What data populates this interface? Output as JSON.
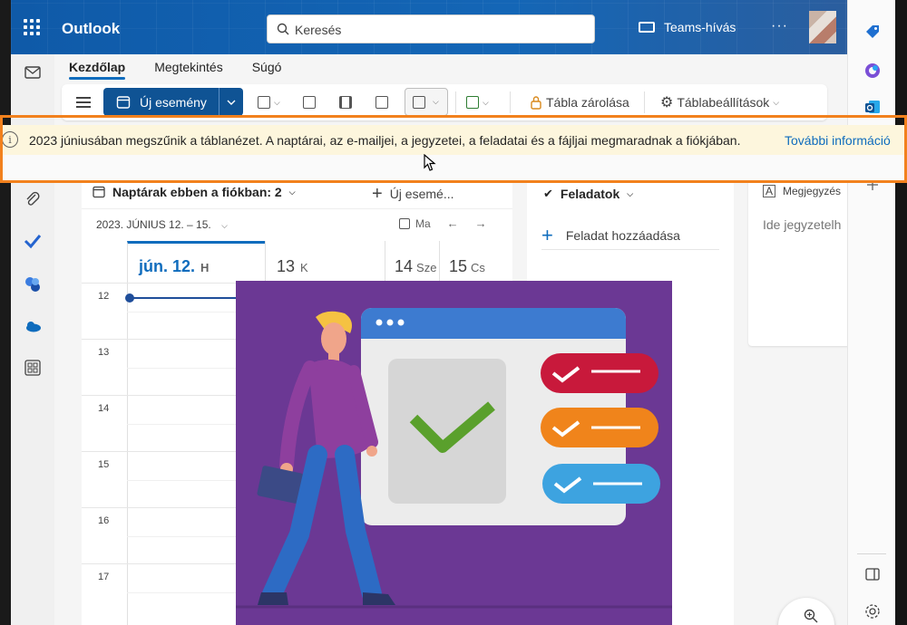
{
  "app": {
    "title": "Outlook"
  },
  "search": {
    "placeholder": "Keresés"
  },
  "header": {
    "teams_call": "Teams-hívás",
    "more": "···"
  },
  "ribbon_tabs": [
    "Kezdőlap",
    "Megtekintés",
    "Súgó"
  ],
  "ribbon": {
    "new_event": "Új esemény",
    "lock_board": "Tábla zárolása",
    "board_settings": "Táblabeállítások"
  },
  "banner": {
    "text": "2023 júniusában megszűnik a táblanézet. A naptárai, az e-mailjei, a jegyzetei, a feladatai és a fájljai megmaradnak a fiókjában.",
    "link": "További információ"
  },
  "calendar": {
    "calendars_label": "Naptárak ebben a fiókban: 2",
    "new_event": "Új esemé...",
    "date_range": "2023. JÚNIUS 12. – 15.",
    "today_button": "Ma",
    "days": [
      {
        "num": "jún. 12.",
        "weekday": "H"
      },
      {
        "num": "13",
        "weekday": "K"
      },
      {
        "num": "14",
        "weekday": "Sze"
      },
      {
        "num": "15",
        "weekday": "Cs"
      }
    ],
    "hours": [
      "12",
      "13",
      "14",
      "15",
      "16",
      "17"
    ]
  },
  "tasks": {
    "title": "Feladatok",
    "add": "Feladat hozzáadása"
  },
  "notes": {
    "title": "Megjegyzés",
    "placeholder": "Ide jegyzetelh"
  },
  "colors": {
    "brand": "#0f6cbd",
    "new_event_bg": "#0f5394",
    "banner_bg": "#fdf6dd",
    "banner_outline": "#f2811d",
    "illustration_bg": "#6b3894",
    "check_red": "#c8193b",
    "check_orange": "#f0841b",
    "check_blue": "#3da3e0",
    "check_green": "#5aa02c"
  }
}
